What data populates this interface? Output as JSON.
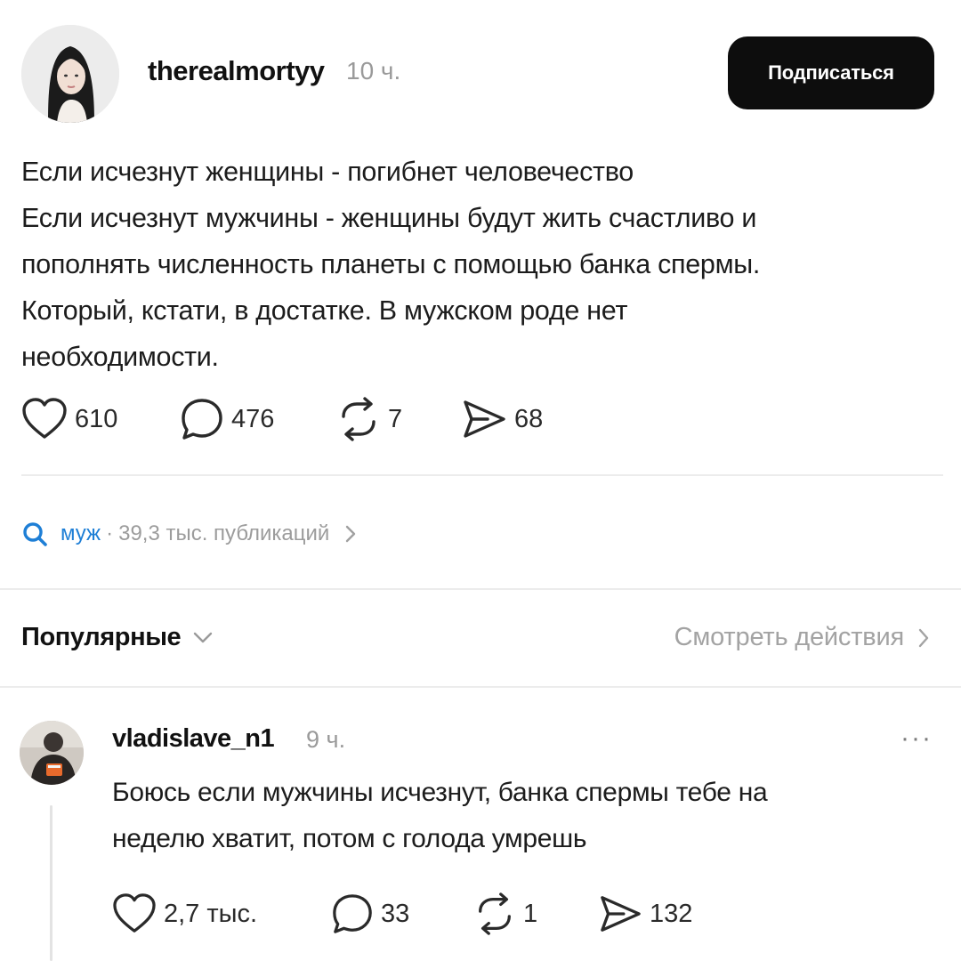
{
  "post": {
    "author": "therealmortyy",
    "time": "10 ч.",
    "follow_label": "Подписаться",
    "text_lines": [
      "Если исчезнут женщины - погибнет человечество",
      "Если исчезнут мужчины - женщины будут жить счастливо и",
      "пополнять численность планеты с помощью банка спермы.",
      "Который, кстати, в достатке. В мужском роде нет",
      "необходимости."
    ],
    "stats": {
      "likes": "610",
      "comments": "476",
      "reposts": "7",
      "shares": "68"
    }
  },
  "tag": {
    "name": "муж",
    "separator": "·",
    "count": "39,3 тыс. публикаций"
  },
  "replies_header": {
    "sort_label": "Популярные",
    "view_activity": "Смотреть действия"
  },
  "reply": {
    "author": "vladislave_n1",
    "time": "9 ч.",
    "more": "···",
    "text_lines": [
      "Боюсь если мужчины исчезнут, банка спермы тебе на",
      "неделю хватит, потом с голода умрешь"
    ],
    "stats": {
      "likes": "2,7 тыс.",
      "comments": "33",
      "reposts": "1",
      "shares": "132"
    }
  },
  "icons": {
    "like": "heart-icon",
    "comment": "comment-bubble-icon",
    "repost": "repost-icon",
    "share": "send-icon",
    "search": "search-icon",
    "chevron": "chevron-right-icon",
    "dropdown": "chevron-down-icon"
  },
  "colors": {
    "accent": "#1e7fd6",
    "button_bg": "#0d0d0d",
    "muted": "#9a9a9a",
    "divider": "#ececec"
  }
}
